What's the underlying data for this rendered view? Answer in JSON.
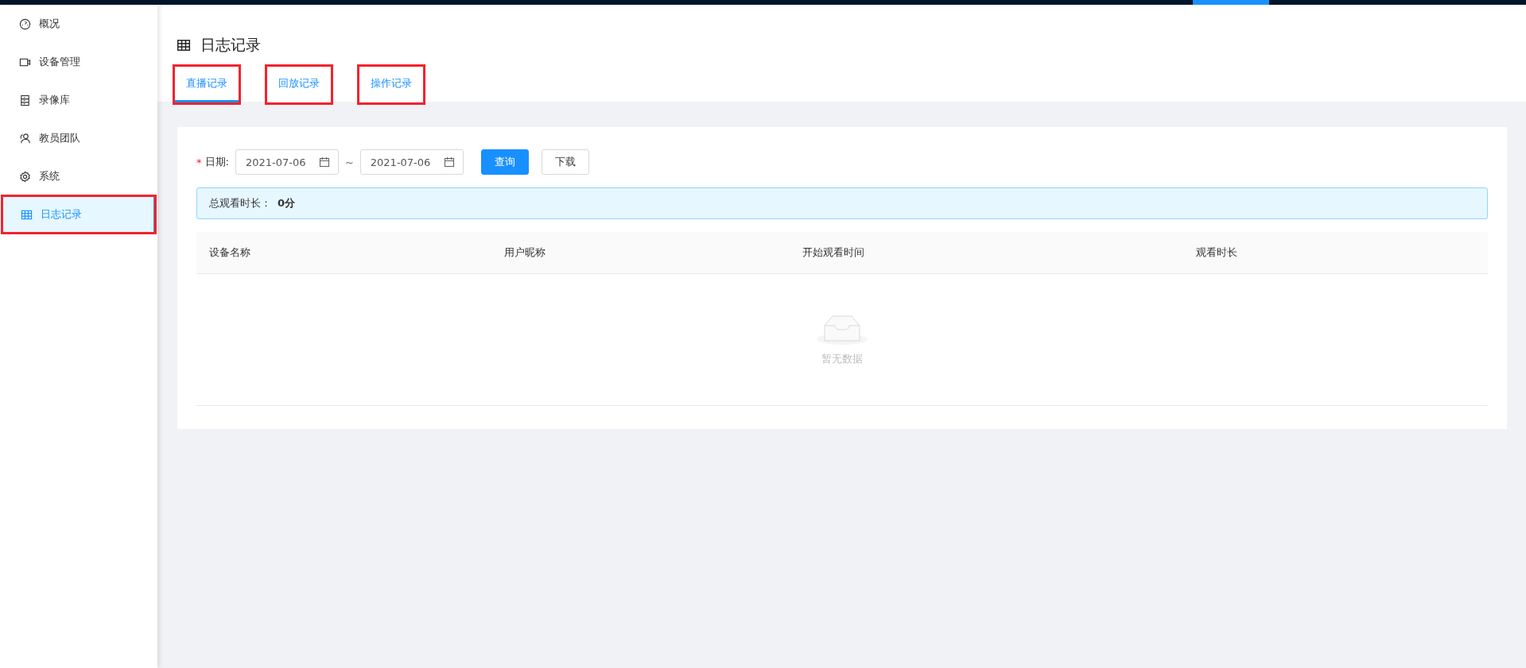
{
  "sidebar": {
    "items": [
      {
        "label": "概况",
        "selected": false,
        "highlighted": false
      },
      {
        "label": "设备管理",
        "selected": false,
        "highlighted": false
      },
      {
        "label": "录像库",
        "selected": false,
        "highlighted": false
      },
      {
        "label": "教员团队",
        "selected": false,
        "highlighted": false
      },
      {
        "label": "系统",
        "selected": false,
        "highlighted": false
      },
      {
        "label": "日志记录",
        "selected": true,
        "highlighted": true
      }
    ]
  },
  "page": {
    "title": "日志记录"
  },
  "tabs": [
    {
      "label": "直播记录",
      "selected": true,
      "highlighted": true
    },
    {
      "label": "回放记录",
      "selected": false,
      "highlighted": true
    },
    {
      "label": "操作记录",
      "selected": false,
      "highlighted": true
    }
  ],
  "filter": {
    "label": "日期:",
    "required_mark": "*",
    "start": "2021-07-06",
    "separator": "~",
    "end": "2021-07-06",
    "buttons": [
      {
        "label": "查询",
        "kind": "primary"
      },
      {
        "label": "下载",
        "kind": "default"
      }
    ]
  },
  "summary": {
    "label": "总观看时长：",
    "value": "0分"
  },
  "table": {
    "columns": [
      "设备名称",
      "用户昵称",
      "开始观看时间",
      "观看时长"
    ],
    "empty_text": "暂无数据"
  }
}
